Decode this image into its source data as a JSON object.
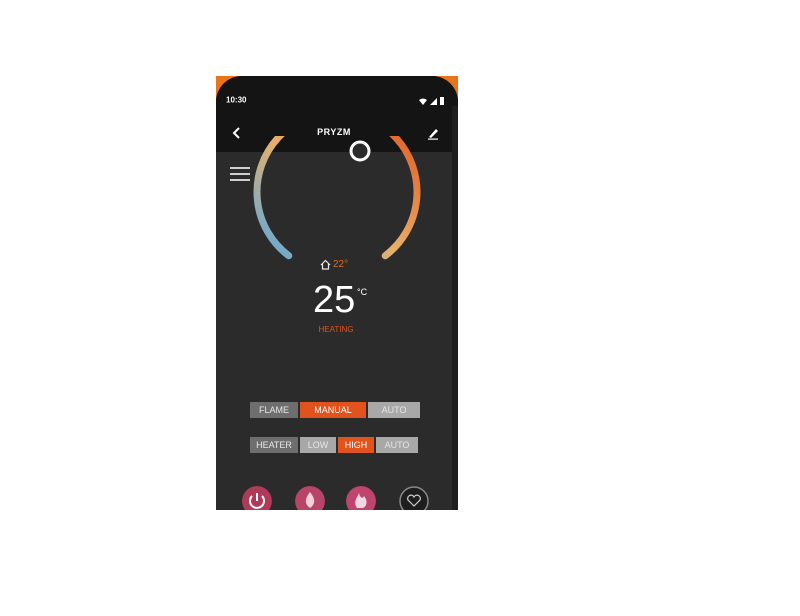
{
  "status_bar": {
    "time": "10:30"
  },
  "app_bar": {
    "title": "PRYZM"
  },
  "thermostat": {
    "room_temp": "22°",
    "set_temp": "25",
    "unit": "°C",
    "state": "HEATING",
    "arc_start_color": "#5aa8e0",
    "arc_end_color": "#e0531c"
  },
  "flame": {
    "label": "FLAME",
    "options": [
      "MANUAL",
      "AUTO"
    ],
    "selected": "MANUAL"
  },
  "heater": {
    "label": "HEATER",
    "options": [
      "LOW",
      "HIGH",
      "AUTO"
    ],
    "selected": "HIGH"
  },
  "bottom_nav": {
    "items": [
      {
        "icon": "power-icon"
      },
      {
        "icon": "flame-icon"
      },
      {
        "icon": "fire-icon"
      },
      {
        "icon": "heart-icon"
      }
    ]
  },
  "colors": {
    "accent": "#e0531c",
    "background": "#2b2b2b",
    "frame": "#e8741c"
  }
}
